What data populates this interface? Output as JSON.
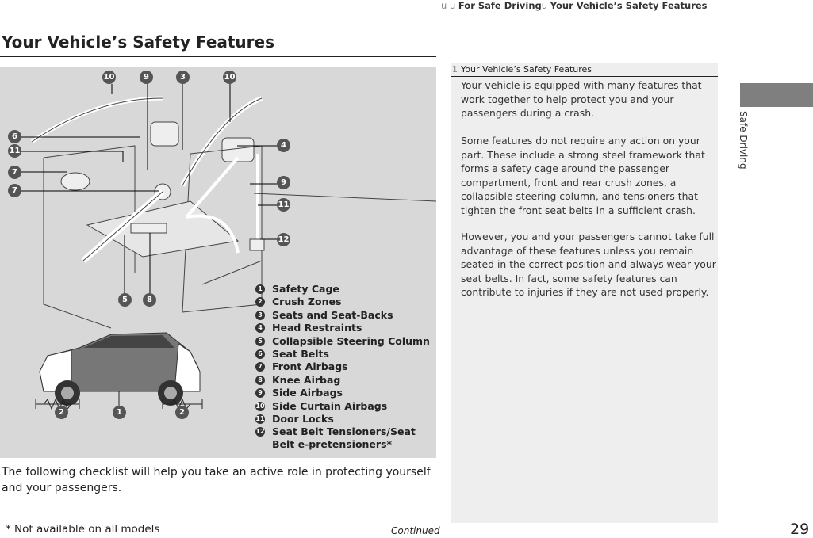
{
  "header": {
    "breadcrumb": [
      "For Safe Driving",
      "Your Vehicle’s Safety Features"
    ],
    "separator": "u"
  },
  "page_title": "Your Vehicle’s Safety Features",
  "figure": {
    "interior_callouts": [
      "10",
      "9",
      "3",
      "10",
      "6",
      "11",
      "7",
      "7",
      "4",
      "9",
      "11",
      "12",
      "5",
      "8"
    ],
    "exterior_callouts": [
      "2",
      "1",
      "2"
    ],
    "legend": [
      {
        "num": "1",
        "label": "Safety Cage"
      },
      {
        "num": "2",
        "label": "Crush Zones"
      },
      {
        "num": "3",
        "label": "Seats and Seat-Backs"
      },
      {
        "num": "4",
        "label": "Head Restraints"
      },
      {
        "num": "5",
        "label": "Collapsible Steering Column"
      },
      {
        "num": "6",
        "label": "Seat Belts"
      },
      {
        "num": "7",
        "label": "Front Airbags"
      },
      {
        "num": "8",
        "label": "Knee Airbag"
      },
      {
        "num": "9",
        "label": "Side Airbags"
      },
      {
        "num": "10",
        "label": "Side Curtain Airbags"
      },
      {
        "num": "11",
        "label": "Door Locks"
      },
      {
        "num": "12",
        "label": "Seat Belt Tensioners/Seat Belt e-pretensioners*"
      }
    ]
  },
  "body_text": "The following checklist will help you take an active role in protecting yourself and your passengers.",
  "note": {
    "marker": "1",
    "heading": "Your Vehicle’s Safety Features",
    "paragraphs": [
      "Your vehicle is equipped with many features that work together to help protect you and your passengers during a crash.",
      "Some features do not require any action on your part. These include a strong steel framework that forms a safety cage around the passenger compartment, front and rear crush zones, a collapsible steering column, and tensioners that tighten the front seat belts in a sufficient crash.",
      "However, you and your passengers cannot take full advantage of these features unless you remain seated in the correct position and always wear your seat belts. In fact, some safety features can contribute to injuries if they are not used properly."
    ]
  },
  "side_tab": "Safe Driving",
  "page_number": "29",
  "footnote": "* Not available on all models",
  "continued": "Continued"
}
